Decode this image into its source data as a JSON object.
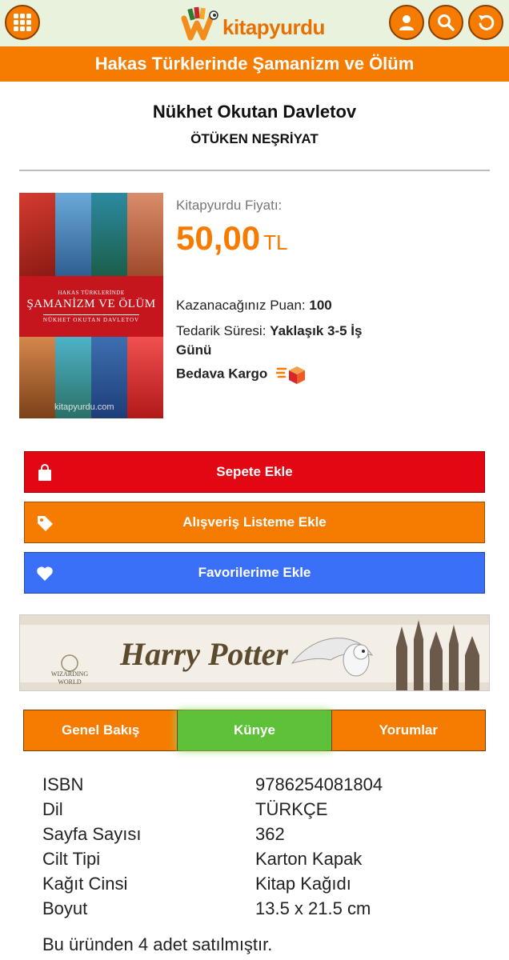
{
  "header": {
    "menu_icon": "grid-menu-icon",
    "logo_text": "kitapyurdu",
    "account_icon": "user-icon",
    "search_icon": "search-icon",
    "back_icon": "back-arrow-icon"
  },
  "product": {
    "title": "Hakas Türklerinde Şamanizm ve Ölüm",
    "author": "Nükhet Okutan Davletov",
    "publisher": "ÖTÜKEN NEŞRİYAT",
    "cover": {
      "small_title": "HAKAS TÜRKLERİNDE",
      "big_title": "ŞAMANİZM VE ÖLÜM",
      "cover_author": "NÜKHET OKUTAN DAVLETOV",
      "watermark": "kitapyurdu.com"
    },
    "price_label": "Kitapyurdu Fiyatı:",
    "price": "50,00",
    "currency": "TL",
    "points_label": "Kazanacağınız Puan:",
    "points": "100",
    "supply_label": "Tedarik Süresi:",
    "supply_value_line1": "Yaklaşık 3-5 İş",
    "supply_value_line2": "Günü",
    "shipping": "Bedava Kargo"
  },
  "actions": {
    "add_to_cart": "Sepete Ekle",
    "add_to_list": "Alışveriş Listeme Ekle",
    "add_to_favorites": "Favorilerime Ekle"
  },
  "banner": {
    "brand": "Harry Potter",
    "line1": "WIZARDING",
    "line2": "WORLD"
  },
  "tabs": [
    {
      "label": "Genel Bakış",
      "active": false
    },
    {
      "label": "Künye",
      "active": true
    },
    {
      "label": "Yorumlar",
      "active": false
    }
  ],
  "specs": [
    {
      "key": "ISBN",
      "value": "9786254081804"
    },
    {
      "key": "Dil",
      "value": "TÜRKÇE"
    },
    {
      "key": "Sayfa Sayısı",
      "value": "362"
    },
    {
      "key": "Cilt Tipi",
      "value": "Karton Kapak"
    },
    {
      "key": "Kağıt Cinsi",
      "value": "Kitap Kağıdı"
    },
    {
      "key": "Boyut",
      "value": "13.5 x 21.5 cm"
    }
  ],
  "sold_text": "Bu üründen 4 adet satılmıştır.",
  "colors": {
    "brand_orange": "#f57c00",
    "cart_red": "#e30613",
    "favorites_blue": "#3a6ff7",
    "tab_active_green": "#5fc13a",
    "header_bg": "#e8f2dc"
  }
}
